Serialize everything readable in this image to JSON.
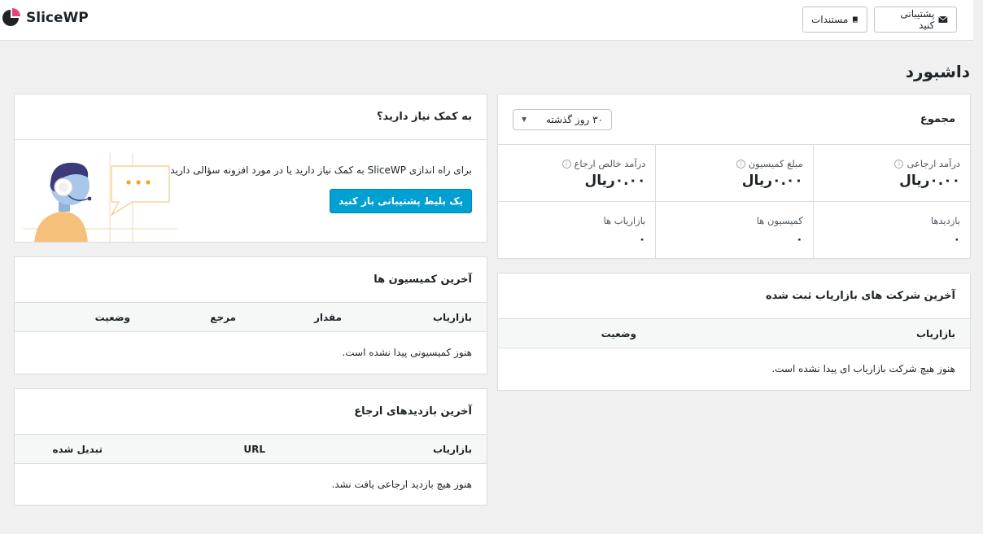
{
  "header": {
    "logo_text": "SliceWP",
    "support_button": "پشتیبانی کنید",
    "docs_button": "مستندات"
  },
  "page_title": "داشبورد",
  "totals": {
    "title": "مجموع",
    "period_select": "۳۰ روز گذشته",
    "stats": [
      {
        "label": "درآمد ارجاعی",
        "value": "۰.۰۰ریال",
        "has_info": true
      },
      {
        "label": "مبلغ کمیسیون",
        "value": "۰.۰۰ریال",
        "has_info": true
      },
      {
        "label": "درآمد خالص ارجاع",
        "value": "۰.۰۰ریال",
        "has_info": true
      },
      {
        "label": "بازدیدها",
        "value": "۰",
        "has_info": false
      },
      {
        "label": "کمیسیون ها",
        "value": "۰",
        "has_info": false
      },
      {
        "label": "بازاریاب ها",
        "value": "۰",
        "has_info": false
      }
    ]
  },
  "latest_affiliates": {
    "title": "آخرین شرکت های بازاریاب ثبت شده",
    "columns": [
      "بازاریاب",
      "وضعیت"
    ],
    "empty": "هنوز هیچ شرکت بازاریاب ای پیدا نشده است."
  },
  "help": {
    "title": "به کمک نیاز دارید؟",
    "text": "برای راه اندازی SliceWP به کمک نیاز دارید یا در مورد افزونه سؤالی دارید؟",
    "button": "یک بلیط پشتیبانی باز کنید"
  },
  "latest_commissions": {
    "title": "آخرین کمیسیون ها",
    "columns": [
      "بازاریاب",
      "مقدار",
      "مرجع",
      "وضعیت"
    ],
    "empty": "هنوز کمیسیونی پیدا نشده است."
  },
  "latest_visits": {
    "title": "آخرین بازدیدهای ارجاع",
    "columns": [
      "بازاریاب",
      "URL",
      "تبدیل شده"
    ],
    "empty": "هنوز هیچ بازدید ارجاعی یافت نشد."
  },
  "colors": {
    "accent": "#00a0d2",
    "logo_pink": "#e5457a",
    "logo_dark": "#1d2327"
  }
}
